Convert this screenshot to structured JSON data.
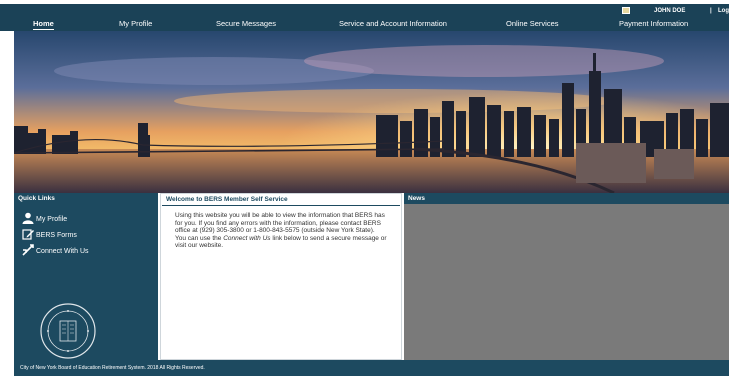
{
  "header": {
    "user_name": "JOHN DOE",
    "separator": "|",
    "logout_label": "Log",
    "nav": [
      {
        "label": "Home"
      },
      {
        "label": "My Profile"
      },
      {
        "label": "Secure Messages"
      },
      {
        "label": "Service and Account Information"
      },
      {
        "label": "Online Services"
      },
      {
        "label": "Payment Information"
      }
    ]
  },
  "quick_links": {
    "title": "Quick Links",
    "items": [
      {
        "label": "My Profile",
        "icon": "user-icon"
      },
      {
        "label": "BERS Forms",
        "icon": "edit-form-icon"
      },
      {
        "label": "Connect With Us",
        "icon": "connect-icon"
      }
    ],
    "seal_text": "BOARD OF EDUCATION · CITY OF NEW YORK"
  },
  "welcome": {
    "title": "Welcome to BERS Member Self Service",
    "text_before": "Using this website you will be able to view the information that BERS has for you.  If you find any errors with the information, please contact BERS office at (929) 305-3800 or 1-800-843-5575 (outside New York State).  You can use the ",
    "text_link": "Connect with Us",
    "text_after": " link below to send a secure message or visit our website."
  },
  "news": {
    "title": "News"
  },
  "footer": {
    "text": "City of New York Board of Education Retirement System. 2018 All Rights Reserved."
  },
  "colors": {
    "nav_bg": "#1b4257",
    "panel_bg": "#1d4a60",
    "news_bg": "#7a7a7a"
  }
}
